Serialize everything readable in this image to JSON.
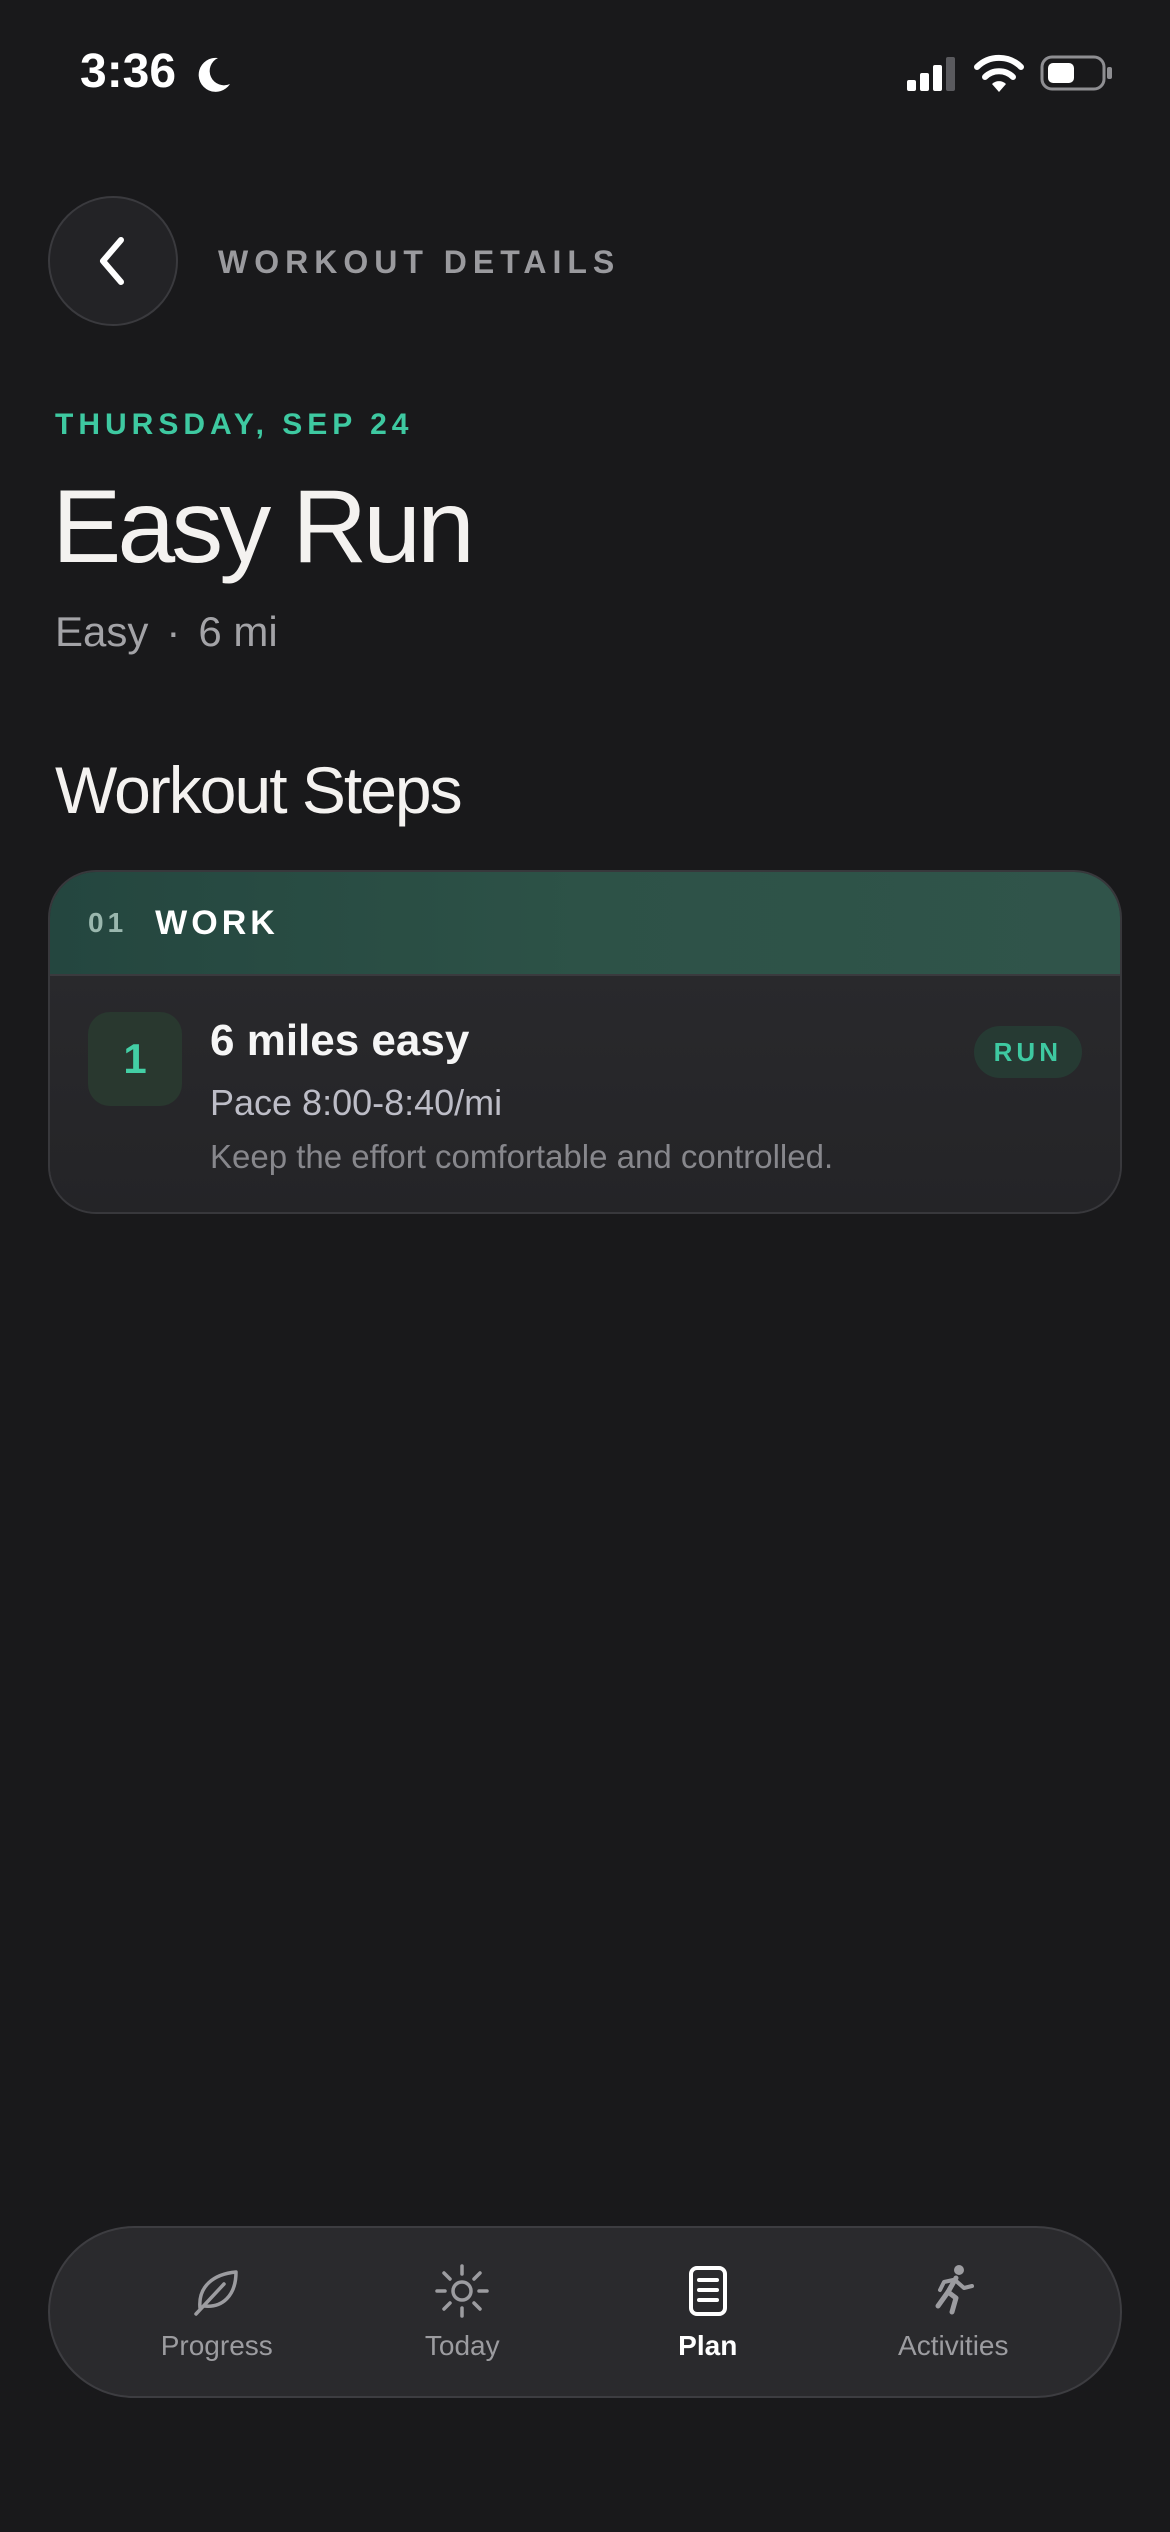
{
  "status_bar": {
    "time": "3:36"
  },
  "header": {
    "title": "WORKOUT DETAILS"
  },
  "workout": {
    "date": "THURSDAY, SEP 24",
    "title": "Easy Run",
    "intensity": "Easy",
    "separator": "·",
    "distance": "6 mi"
  },
  "steps_section": {
    "title": "Workout Steps",
    "blocks": [
      {
        "number": "01",
        "name": "WORK",
        "steps": [
          {
            "index": "1",
            "title": "6 miles easy",
            "pace": "Pace 8:00-8:40/mi",
            "note": "Keep the effort comfortable and controlled.",
            "type": "RUN"
          }
        ]
      }
    ]
  },
  "tab_bar": {
    "tabs": [
      {
        "label": "Progress",
        "icon": "leaf-icon",
        "active": false
      },
      {
        "label": "Today",
        "icon": "sun-icon",
        "active": false
      },
      {
        "label": "Plan",
        "icon": "clipboard-icon",
        "active": true
      },
      {
        "label": "Activities",
        "icon": "runner-icon",
        "active": false
      }
    ]
  },
  "colors": {
    "background": "#19191b",
    "accent": "#3ec9a1",
    "card": "#232326",
    "block_header": "#2d5247"
  }
}
